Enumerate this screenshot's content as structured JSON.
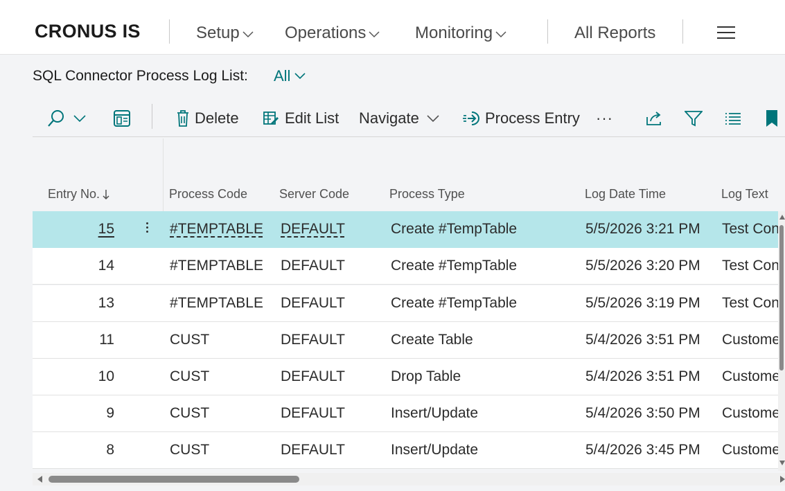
{
  "app": {
    "brand": "CRONUS IS",
    "nav": [
      {
        "label": "Setup",
        "has_dropdown": true
      },
      {
        "label": "Operations",
        "has_dropdown": true
      },
      {
        "label": "Monitoring",
        "has_dropdown": true
      },
      {
        "label": "All Reports",
        "has_dropdown": false
      }
    ],
    "menu_icon": "hamburger-icon"
  },
  "page": {
    "title": "SQL Connector Process Log List:",
    "view": "All"
  },
  "actions": {
    "search_icon": "search-icon",
    "delete_label": "Delete",
    "edit_list_label": "Edit List",
    "navigate_label": "Navigate",
    "process_entry_label": "Process Entry",
    "more_label": "···"
  },
  "colors": {
    "accent": "#00757a",
    "selected_row": "#b5e6ea",
    "brand_text": "#1b1b1b"
  },
  "table": {
    "columns": [
      "Entry No.",
      "Process Code",
      "Server Code",
      "Process Type",
      "Log Date Time",
      "Log Text"
    ],
    "sort": {
      "column": "Entry No.",
      "direction": "descending"
    },
    "rows": [
      {
        "entry_no": "15",
        "process_code": "#TEMPTABLE",
        "server_code": "DEFAULT",
        "process_type": "Create #TempTable",
        "log_date_time": "5/5/2026 3:21 PM",
        "log_text": "Test Con",
        "selected": true
      },
      {
        "entry_no": "14",
        "process_code": "#TEMPTABLE",
        "server_code": "DEFAULT",
        "process_type": "Create #TempTable",
        "log_date_time": "5/5/2026 3:20 PM",
        "log_text": "Test Con"
      },
      {
        "entry_no": "13",
        "process_code": "#TEMPTABLE",
        "server_code": "DEFAULT",
        "process_type": "Create #TempTable",
        "log_date_time": "5/5/2026 3:19 PM",
        "log_text": "Test Con"
      },
      {
        "entry_no": "11",
        "process_code": "CUST",
        "server_code": "DEFAULT",
        "process_type": "Create Table",
        "log_date_time": "5/4/2026 3:51 PM",
        "log_text": "Custome"
      },
      {
        "entry_no": "10",
        "process_code": "CUST",
        "server_code": "DEFAULT",
        "process_type": "Drop Table",
        "log_date_time": "5/4/2026 3:51 PM",
        "log_text": "Custome"
      },
      {
        "entry_no": "9",
        "process_code": "CUST",
        "server_code": "DEFAULT",
        "process_type": "Insert/Update",
        "log_date_time": "5/4/2026 3:50 PM",
        "log_text": "Custome"
      },
      {
        "entry_no": "8",
        "process_code": "CUST",
        "server_code": "DEFAULT",
        "process_type": "Insert/Update",
        "log_date_time": "5/4/2026 3:45 PM",
        "log_text": "Custome"
      }
    ]
  }
}
